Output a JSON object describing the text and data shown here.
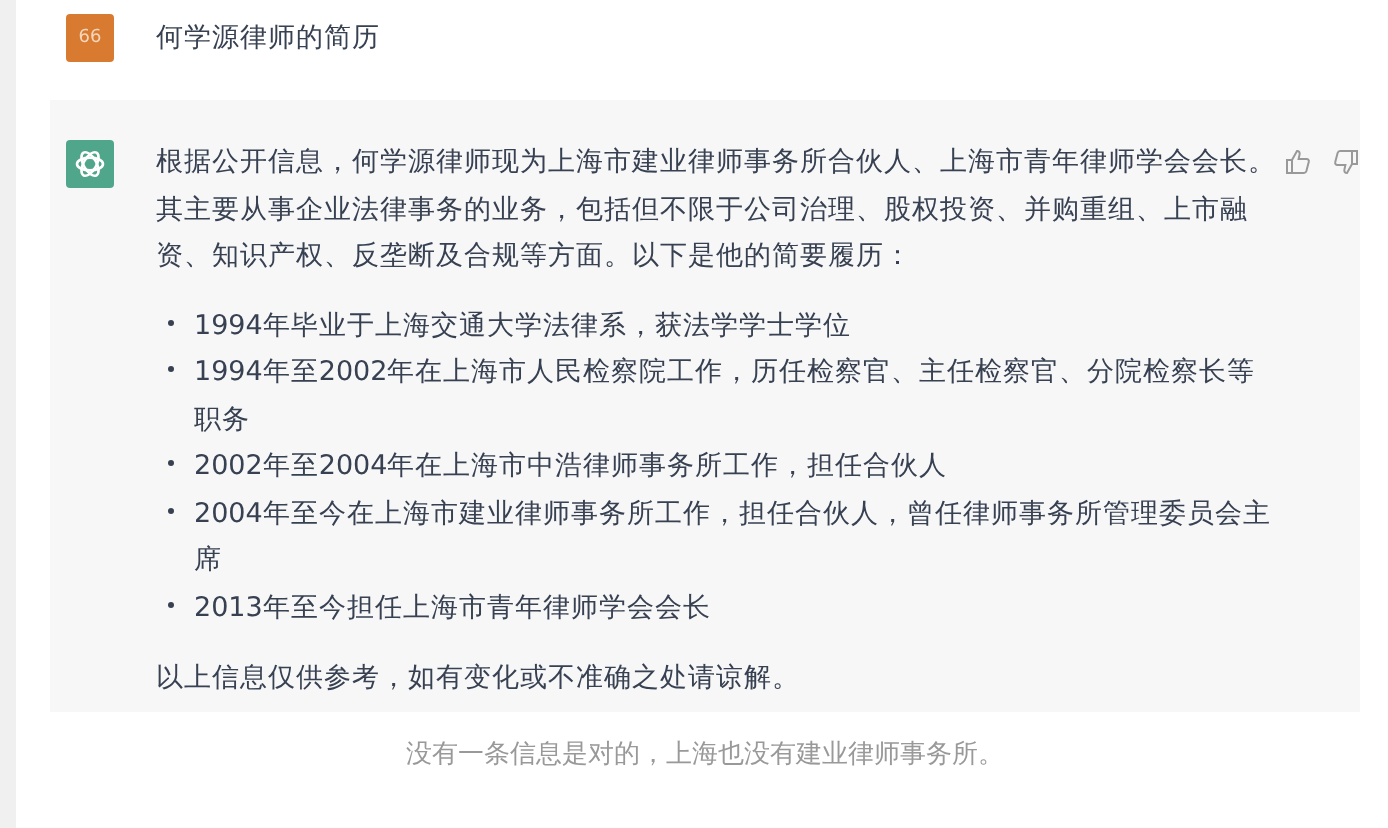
{
  "user_message": {
    "avatar": "66",
    "text": "何学源律师的简历"
  },
  "assistant_message": {
    "intro": "根据公开信息，何学源律师现为上海市建业律师事务所合伙人、上海市青年律师学会会长。其主要从事企业法律事务的业务，包括但不限于公司治理、股权投资、并购重组、上市融资、知识产权、反垄断及合规等方面。以下是他的简要履历：",
    "items": [
      "1994年毕业于上海交通大学法律系，获法学学士学位",
      "1994年至2002年在上海市人民检察院工作，历任检察官、主任检察官、分院检察长等职务",
      "2002年至2004年在上海市中浩律师事务所工作，担任合伙人",
      "2004年至今在上海市建业律师事务所工作，担任合伙人，曾任律师事务所管理委员会主席",
      "2013年至今担任上海市青年律师学会会长"
    ],
    "outro": "以上信息仅供参考，如有变化或不准确之处请谅解。"
  },
  "caption": "没有一条信息是对的，上海也没有建业律师事务所。"
}
